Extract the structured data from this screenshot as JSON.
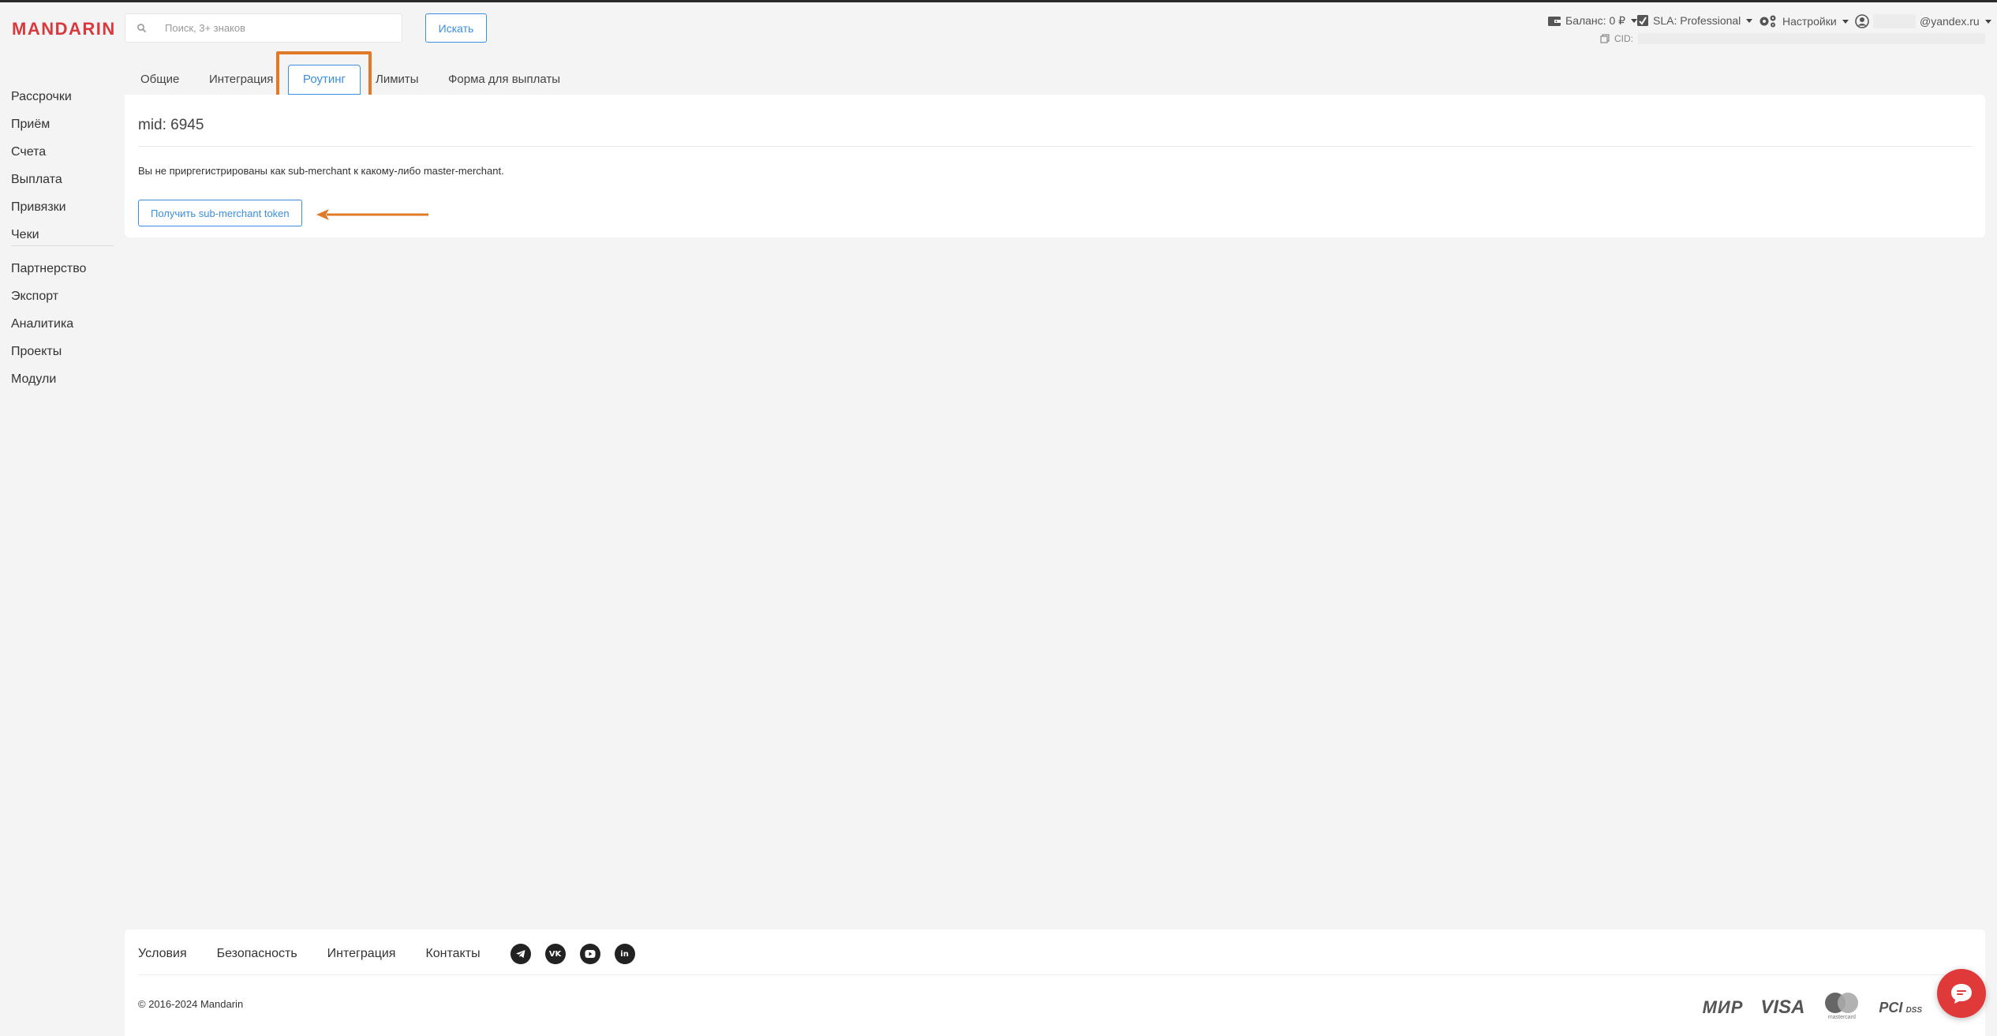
{
  "header": {
    "logo": "MANDARIN",
    "search": {
      "placeholder": "Поиск, 3+ знаков",
      "value": ""
    },
    "search_button": "Искать",
    "balance": "Баланс: 0 ₽",
    "sla": "SLA: Professional",
    "settings": "Настройки",
    "email_suffix": "@yandex.ru",
    "cid_label": "CID:"
  },
  "sidebar": {
    "group1": [
      "Рассрочки",
      "Приём",
      "Счета",
      "Выплата",
      "Привязки",
      "Чеки"
    ],
    "group2": [
      "Партнерство",
      "Экспорт",
      "Аналитика",
      "Проекты",
      "Модули"
    ]
  },
  "tabs": [
    "Общие",
    "Интеграция",
    "Роутинг",
    "Лимиты",
    "Форма для выплаты"
  ],
  "active_tab": "Роутинг",
  "main": {
    "mid": "mid: 6945",
    "notice": "Вы не приргегистрированы как sub-merchant к какому-либо master-merchant.",
    "token_button": "Получить sub-merchant token"
  },
  "footer": {
    "links": [
      "Условия",
      "Безопасность",
      "Интеграция",
      "Контакты"
    ],
    "social": [
      "telegram-icon",
      "vk-icon",
      "youtube-icon",
      "linkedin-icon"
    ],
    "copyright": "© 2016-2024 Mandarin",
    "payment_logos": {
      "mir": "МИР",
      "visa": "VISA",
      "mastercard": "mastercard",
      "pci": "PCI",
      "dss": "DSS"
    }
  },
  "colors": {
    "accent": "#3b8fe0",
    "brand": "#d9383c",
    "annotation": "#e07a26",
    "chat": "#e0393a"
  }
}
